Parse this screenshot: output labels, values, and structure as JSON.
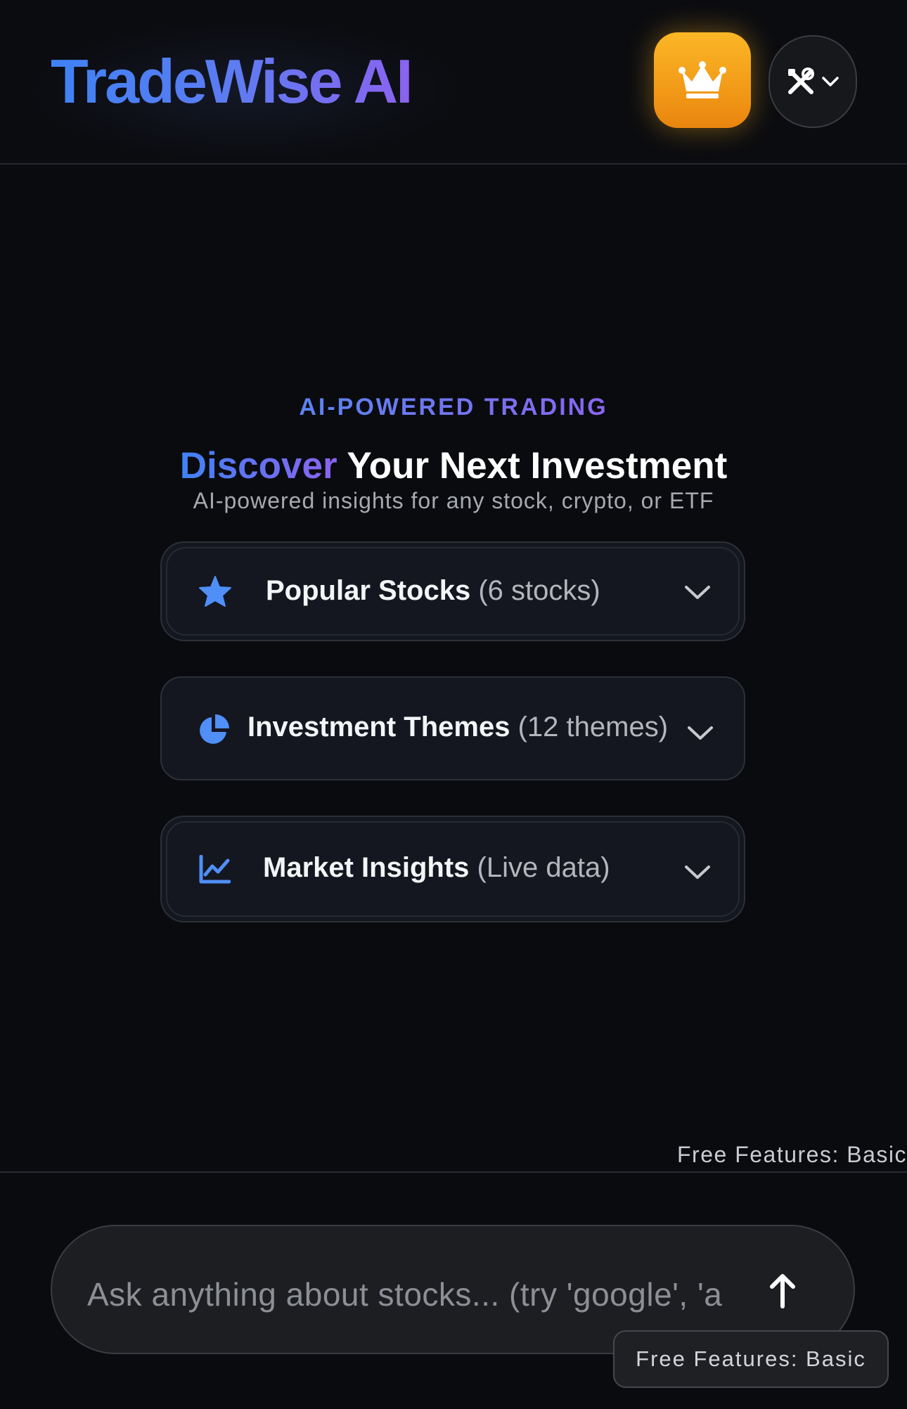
{
  "header": {
    "logo": "TradeWise AI",
    "premium_icon": "crown-icon",
    "tools_icon": "tools-icon",
    "tools_chevron_icon": "chevron-down-icon"
  },
  "hero": {
    "eyebrow": "AI-POWERED TRADING",
    "headline_highlight": "Discover",
    "headline_rest": "Your Next Investment",
    "subhead": "AI-powered insights for any stock, crypto, or ETF"
  },
  "sections": [
    {
      "icon": "star-icon",
      "label": "Popular Stocks",
      "count": "(6 stocks)"
    },
    {
      "icon": "pie-chart-icon",
      "label": "Investment Themes",
      "count": "(12 themes)"
    },
    {
      "icon": "line-chart-icon",
      "label": "Market Insights",
      "count": "(Live data)"
    }
  ],
  "footer": {
    "free_features_top": "Free Features: Basic",
    "input_placeholder": "Ask anything about stocks... (try 'google', 'a",
    "send_icon": "arrow-up-icon",
    "free_features_badge": "Free Features: Basic"
  },
  "colors": {
    "background": "#0a0b0f",
    "brand_blue": "#3f82f5",
    "brand_purple": "#8b63ef",
    "premium_orange": "#f29a18",
    "icon_blue": "#4f8ff7"
  }
}
